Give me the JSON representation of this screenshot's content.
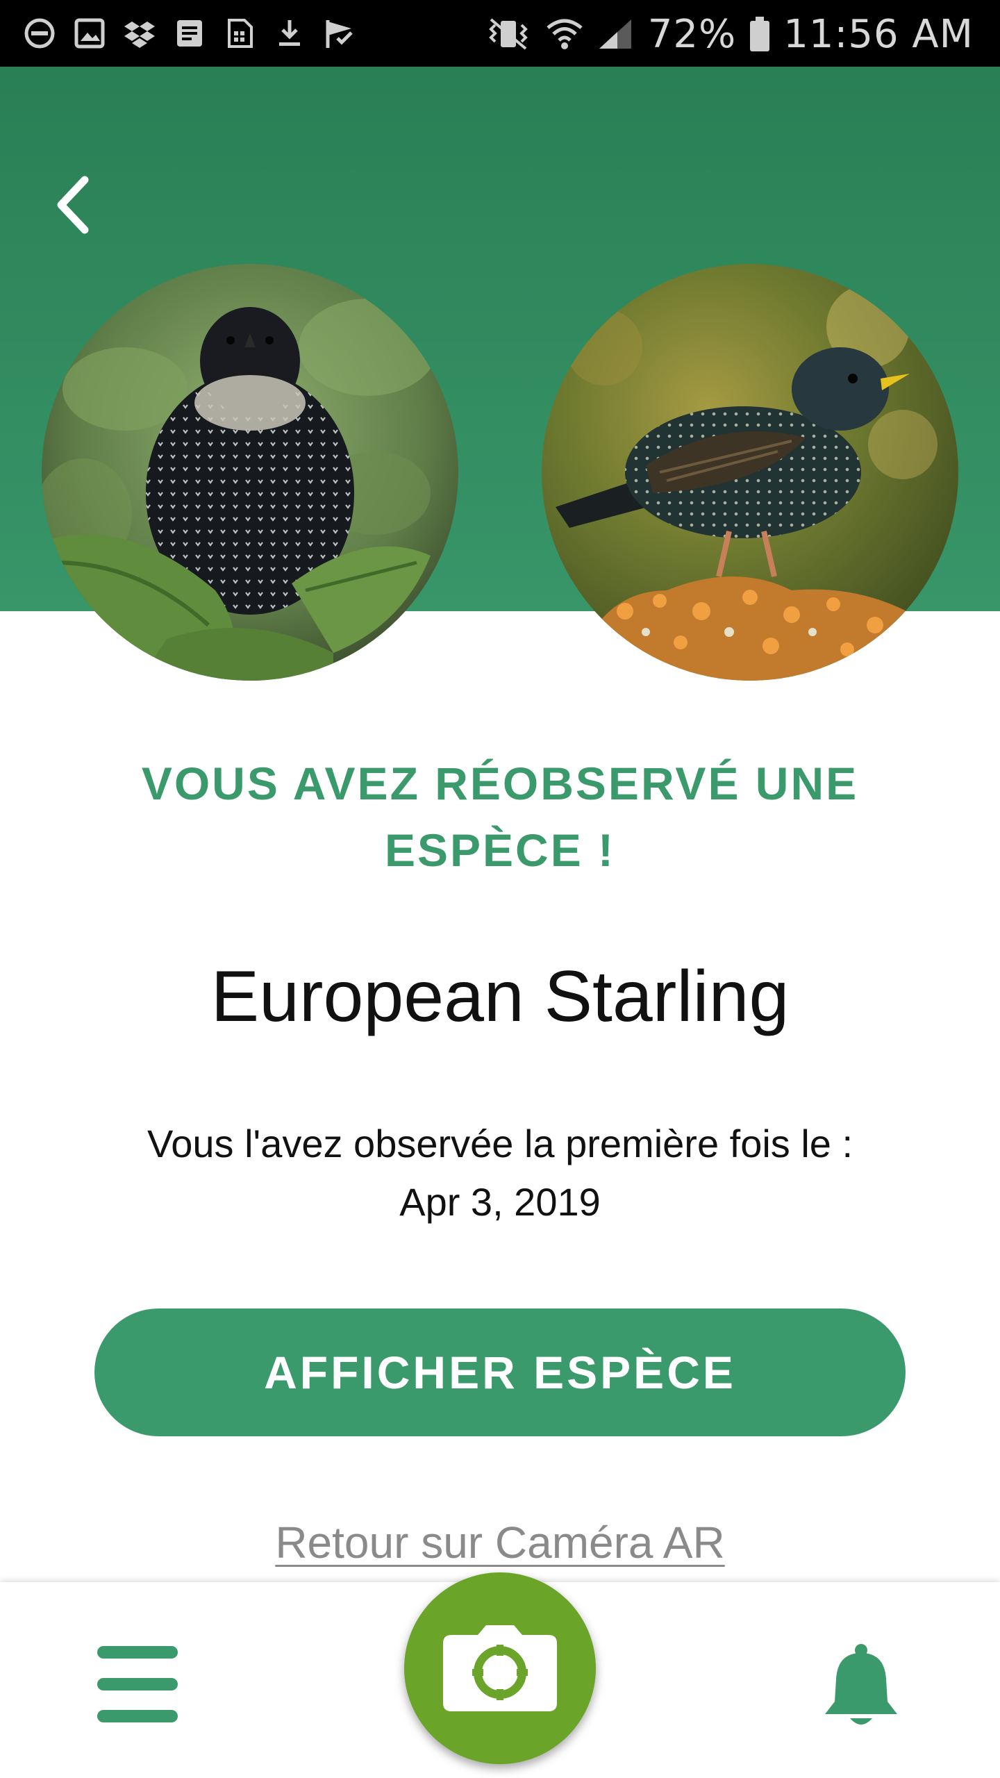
{
  "status_bar": {
    "battery": "72%",
    "time": "11:56 AM",
    "left_icons": [
      "do-not-disturb-icon",
      "gallery-icon",
      "dropbox-icon",
      "document-icon",
      "sim-icon",
      "download-icon",
      "check-flag-icon"
    ],
    "right_icons": [
      "vibrate-icon",
      "wifi-icon",
      "signal-icon",
      "battery-icon"
    ]
  },
  "header": {
    "back_icon": "chevron-left-icon",
    "photo_left": "starling-front-photo",
    "photo_right": "starling-side-photo"
  },
  "content": {
    "headline": "VOUS AVEZ RÉOBSERVÉ UNE ESPÈCE !",
    "species_name": "European Starling",
    "first_seen_label": "Vous l'avez observée la première fois le :",
    "first_seen_date": "Apr 3, 2019",
    "show_species_button": "AFFICHER ESPÈCE",
    "back_link": "Retour sur Caméra AR"
  },
  "bottom_nav": {
    "menu_icon": "hamburger-menu-icon",
    "camera_icon": "camera-icon",
    "notification_icon": "bell-icon"
  },
  "colors": {
    "header_green": "#2f8a5e",
    "accent_green": "#3a9a6b",
    "camera_green": "#6aa52a",
    "link_gray": "#8a8a8a"
  }
}
